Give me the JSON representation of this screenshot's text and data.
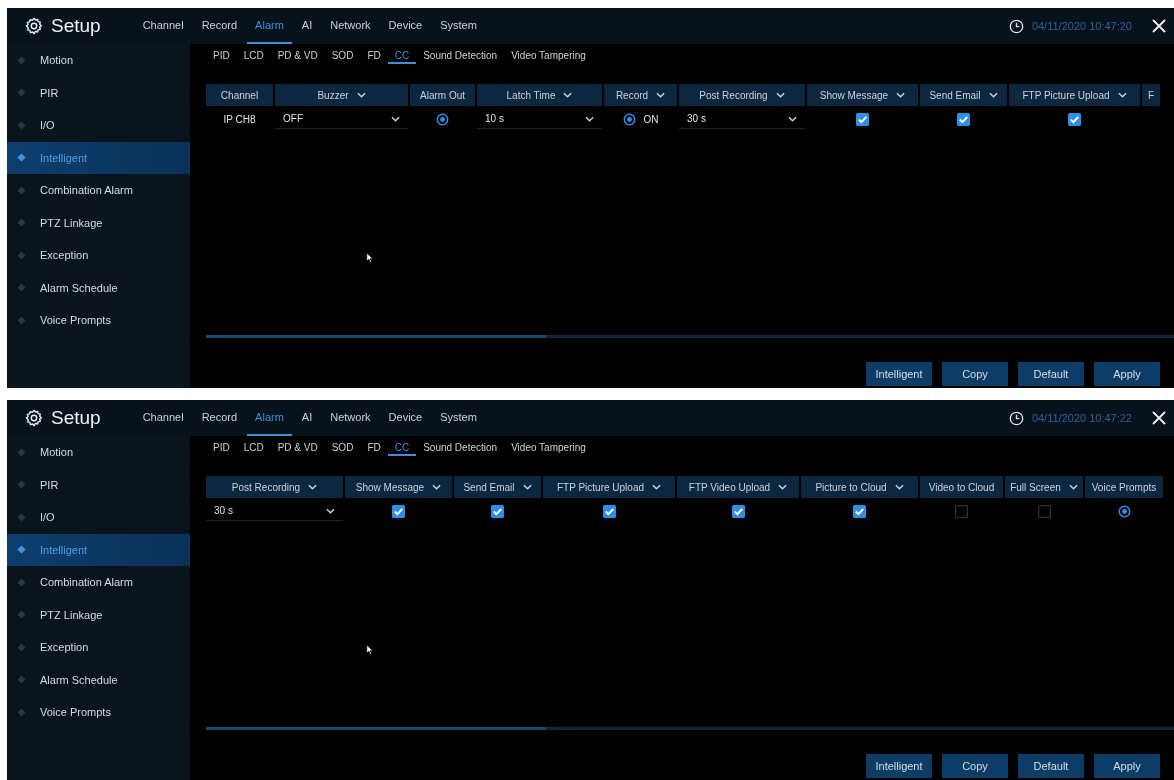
{
  "screens": [
    {
      "title": "Setup",
      "nav_tabs": [
        {
          "label": "Channel",
          "selected": false
        },
        {
          "label": "Record",
          "selected": false
        },
        {
          "label": "Alarm",
          "selected": true
        },
        {
          "label": "AI",
          "selected": false
        },
        {
          "label": "Network",
          "selected": false
        },
        {
          "label": "Device",
          "selected": false
        },
        {
          "label": "System",
          "selected": false
        }
      ],
      "datetime": "04/11/2020 10:47:20",
      "sidebar": {
        "items": [
          {
            "label": "Motion",
            "selected": false
          },
          {
            "label": "PIR",
            "selected": false
          },
          {
            "label": "I/O",
            "selected": false
          },
          {
            "label": "Intelligent",
            "selected": true
          },
          {
            "label": "Combination Alarm",
            "selected": false
          },
          {
            "label": "PTZ Linkage",
            "selected": false
          },
          {
            "label": "Exception",
            "selected": false
          },
          {
            "label": "Alarm Schedule",
            "selected": false
          },
          {
            "label": "Voice Prompts",
            "selected": false
          }
        ]
      },
      "sub_tabs": [
        {
          "label": "PID",
          "selected": false
        },
        {
          "label": "LCD",
          "selected": false
        },
        {
          "label": "PD & VD",
          "selected": false
        },
        {
          "label": "SOD",
          "selected": false
        },
        {
          "label": "FD",
          "selected": false
        },
        {
          "label": "CC",
          "selected": true
        },
        {
          "label": "Sound Detection",
          "selected": false
        },
        {
          "label": "Video Tampering",
          "selected": false
        }
      ],
      "table": {
        "columns": [
          {
            "label": "Channel",
            "dropdown": false
          },
          {
            "label": "Buzzer",
            "dropdown": true
          },
          {
            "label": "Alarm Out",
            "dropdown": false
          },
          {
            "label": "Latch Time",
            "dropdown": true
          },
          {
            "label": "Record",
            "dropdown": true
          },
          {
            "label": "Post Recording",
            "dropdown": true
          },
          {
            "label": "Show Message",
            "dropdown": true
          },
          {
            "label": "Send Email",
            "dropdown": true
          },
          {
            "label": "FTP Picture Upload",
            "dropdown": true
          },
          {
            "label": "F",
            "dropdown": false
          }
        ],
        "rows": [
          {
            "cells": [
              {
                "kind": "text",
                "text": "IP CH8"
              },
              {
                "kind": "select",
                "value": "OFF"
              },
              {
                "kind": "radio",
                "checked": true
              },
              {
                "kind": "select",
                "value": "10 s"
              },
              {
                "kind": "radio",
                "checked": true,
                "text": "ON"
              },
              {
                "kind": "select",
                "value": "30 s"
              },
              {
                "kind": "checkbox",
                "checked": true
              },
              {
                "kind": "checkbox",
                "checked": true
              },
              {
                "kind": "checkbox",
                "checked": true
              }
            ]
          }
        ]
      },
      "buttons": [
        "Intelligent",
        "Copy",
        "Default",
        "Apply"
      ]
    },
    {
      "title": "Setup",
      "nav_tabs": [
        {
          "label": "Channel",
          "selected": false
        },
        {
          "label": "Record",
          "selected": false
        },
        {
          "label": "Alarm",
          "selected": true
        },
        {
          "label": "AI",
          "selected": false
        },
        {
          "label": "Network",
          "selected": false
        },
        {
          "label": "Device",
          "selected": false
        },
        {
          "label": "System",
          "selected": false
        }
      ],
      "datetime": "04/11/2020 10:47:22",
      "sidebar": {
        "items": [
          {
            "label": "Motion",
            "selected": false
          },
          {
            "label": "PIR",
            "selected": false
          },
          {
            "label": "I/O",
            "selected": false
          },
          {
            "label": "Intelligent",
            "selected": true
          },
          {
            "label": "Combination Alarm",
            "selected": false
          },
          {
            "label": "PTZ Linkage",
            "selected": false
          },
          {
            "label": "Exception",
            "selected": false
          },
          {
            "label": "Alarm Schedule",
            "selected": false
          },
          {
            "label": "Voice Prompts",
            "selected": false
          }
        ]
      },
      "sub_tabs": [
        {
          "label": "PID",
          "selected": false
        },
        {
          "label": "LCD",
          "selected": false
        },
        {
          "label": "PD & VD",
          "selected": false
        },
        {
          "label": "SOD",
          "selected": false
        },
        {
          "label": "FD",
          "selected": false
        },
        {
          "label": "CC",
          "selected": true
        },
        {
          "label": "Sound Detection",
          "selected": false
        },
        {
          "label": "Video Tampering",
          "selected": false
        }
      ],
      "table": {
        "columns": [
          {
            "label": "Post Recording",
            "dropdown": true
          },
          {
            "label": "Show Message",
            "dropdown": true
          },
          {
            "label": "Send Email",
            "dropdown": true
          },
          {
            "label": "FTP Picture Upload",
            "dropdown": true
          },
          {
            "label": "FTP Video Upload",
            "dropdown": true
          },
          {
            "label": "Picture to Cloud",
            "dropdown": true
          },
          {
            "label": "Video to Cloud",
            "dropdown": false
          },
          {
            "label": "Full Screen",
            "dropdown": true
          },
          {
            "label": "Voice Prompts",
            "dropdown": false
          }
        ],
        "rows": [
          {
            "cells": [
              {
                "kind": "select",
                "value": "30 s"
              },
              {
                "kind": "checkbox",
                "checked": true
              },
              {
                "kind": "checkbox",
                "checked": true
              },
              {
                "kind": "checkbox",
                "checked": true
              },
              {
                "kind": "checkbox",
                "checked": true
              },
              {
                "kind": "checkbox",
                "checked": true
              },
              {
                "kind": "checkbox",
                "checked": false
              },
              {
                "kind": "checkbox",
                "checked": false
              },
              {
                "kind": "radio",
                "checked": true
              }
            ]
          }
        ]
      },
      "buttons": [
        "Intelligent",
        "Copy",
        "Default",
        "Apply"
      ]
    }
  ]
}
